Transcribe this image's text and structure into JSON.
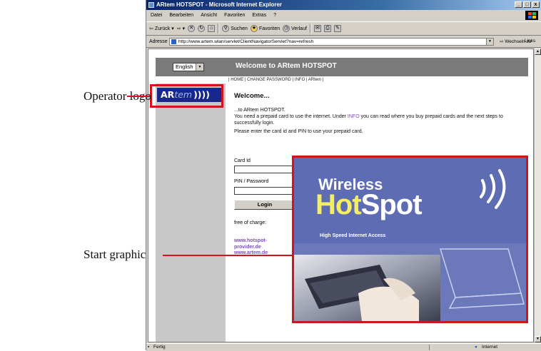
{
  "annotations": {
    "operator_logo": "Operator logo",
    "start_graphic": "Start graphic",
    "accent_color": "#d2141c"
  },
  "browser": {
    "title": "ARtem HOTSPOT - Microsoft Internet Explorer",
    "window_buttons": [
      "_",
      "□",
      "x"
    ],
    "menu": [
      "Datei",
      "Bearbeiten",
      "Ansicht",
      "Favoriten",
      "Extras",
      "?"
    ],
    "toolbar": {
      "back": "Zurück",
      "forward_icon": "forward-arrow-icon",
      "search": "Suchen",
      "favorites": "Favoriten",
      "history": "Verlauf"
    },
    "address_label": "Adresse",
    "address_value": "http://www.artem.wlan/servlet/ClientNavigatorServlet?nav=refresh",
    "go_label": "Wechseln zu",
    "links_label": "Links",
    "status_left": "Fertig",
    "status_right": "Internet"
  },
  "page": {
    "language": "English",
    "header_title": "Welcome to ARtem HOTSPOT",
    "nav": "| HOME | CHANGE PASSWORD | INFO | ARtem |",
    "logo": {
      "part1": "AR",
      "part2": "tem",
      "waves": "))))"
    },
    "welcome_heading": "Welcome...",
    "intro_line": "...to ARtem HOTSPOT.",
    "intro_pre": "You need a prepaid card to use the internet. Under ",
    "intro_link": "INFO",
    "intro_post": " you can read where you buy prepaid cards and the next steps to successfully login.",
    "instruction": "Please enter the card id and PIN to use your prepaid card.",
    "card_id_label": "Card Id",
    "pin_label": "PIN / Password",
    "login_label": "Login",
    "free_label": "free of charge:",
    "free_link_1": "www.hotspot-provider.de",
    "free_link_2": "www.artem.de"
  },
  "graphic": {
    "line1": "Wireless",
    "line2_a": "Hot",
    "line2_b": "Spot",
    "tagline": "High Speed Internet Access",
    "bg_color": "#6b79bb",
    "accent_yellow": "#f4ee60"
  }
}
